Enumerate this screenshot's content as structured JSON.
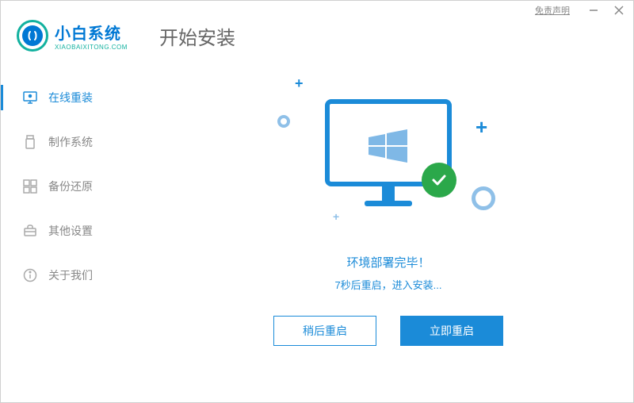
{
  "titlebar": {
    "disclaimer": "免责声明"
  },
  "logo": {
    "title": "小白系统",
    "subtitle": "XIAOBAIXITONG.COM"
  },
  "page_title": "开始安装",
  "sidebar": {
    "items": [
      {
        "label": "在线重装"
      },
      {
        "label": "制作系统"
      },
      {
        "label": "备份还原"
      },
      {
        "label": "其他设置"
      },
      {
        "label": "关于我们"
      }
    ]
  },
  "main": {
    "status": "环境部署完毕！",
    "substatus": "7秒后重启，进入安装...",
    "btn_later": "稍后重启",
    "btn_now": "立即重启"
  }
}
